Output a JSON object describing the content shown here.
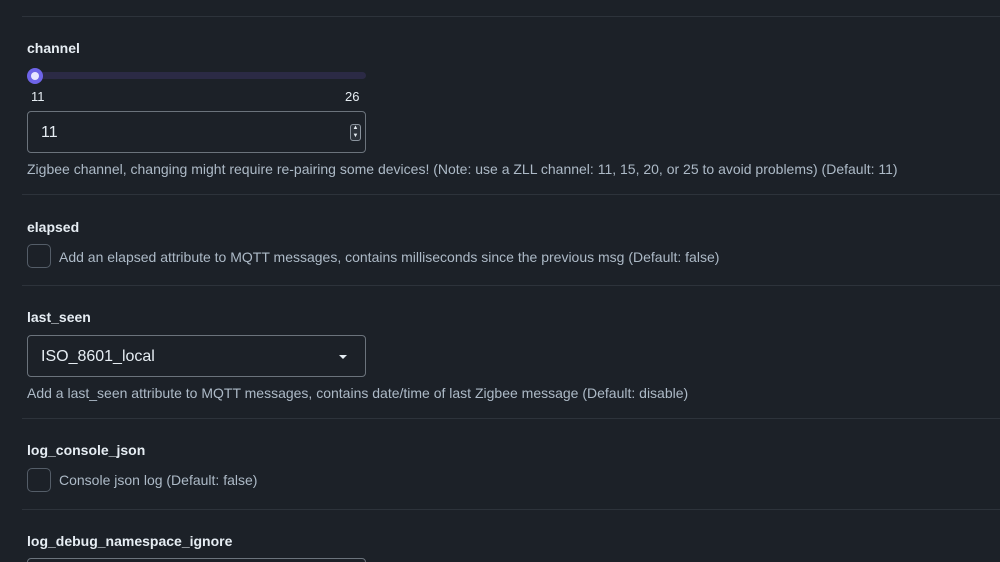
{
  "channel": {
    "label": "channel",
    "slider": {
      "min": 11,
      "max": 26,
      "value": 11,
      "min_label": "11",
      "max_label": "26"
    },
    "input_value": "11",
    "help": "Zigbee channel, changing might require re-pairing some devices! (Note: use a ZLL channel: 11, 15, 20, or 25 to avoid problems) (Default: 11)"
  },
  "elapsed": {
    "label": "elapsed",
    "checked": false,
    "checkbox_label": "Add an elapsed attribute to MQTT messages, contains milliseconds since the previous msg (Default: false)"
  },
  "last_seen": {
    "label": "last_seen",
    "selected": "ISO_8601_local",
    "help": "Add a last_seen attribute to MQTT messages, contains date/time of last Zigbee message (Default: disable)"
  },
  "log_console_json": {
    "label": "log_console_json",
    "checked": false,
    "checkbox_label": "Console json log (Default: false)"
  },
  "log_debug_namespace_ignore": {
    "label": "log_debug_namespace_ignore"
  },
  "colors": {
    "background": "#1c2128",
    "accent": "#6e64e8",
    "divider": "#2d333b"
  },
  "icons": {
    "stepper": "spin-stepper-icon",
    "dropdown": "caret-down-icon"
  }
}
